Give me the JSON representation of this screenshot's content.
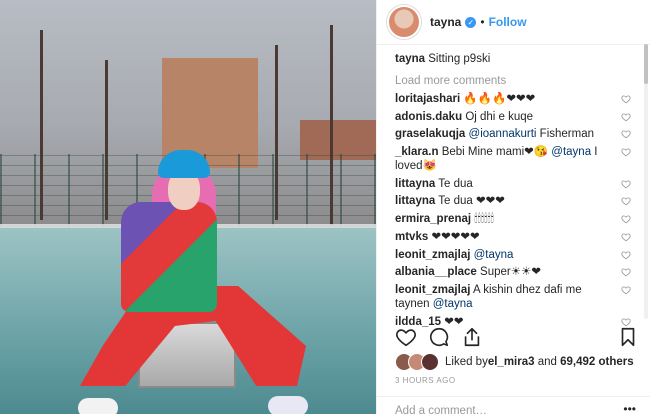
{
  "post": {
    "username": "tayna",
    "follow_label": "Follow",
    "dot": "•",
    "verified_glyph": "✓",
    "caption_user": "tayna",
    "caption_text": "Sitting p9ski",
    "load_more": "Load more comments",
    "comments": [
      {
        "user": "loritajashari",
        "parts": [
          {
            "t": "🔥🔥🔥❤❤❤",
            "m": false
          }
        ]
      },
      {
        "user": "adonis.daku",
        "parts": [
          {
            "t": "Oj dhi e kuqe",
            "m": false
          }
        ]
      },
      {
        "user": "graselakuqja",
        "parts": [
          {
            "t": "@ioannakurti",
            "m": true
          },
          {
            "t": " Fisherman",
            "m": false
          }
        ]
      },
      {
        "user": "_klara.n",
        "parts": [
          {
            "t": "Bebi Mine mami❤😘 ",
            "m": false
          },
          {
            "t": "@tayna",
            "m": true
          },
          {
            "t": " I loved😻",
            "m": false
          }
        ]
      },
      {
        "user": "littayna",
        "parts": [
          {
            "t": "Te dua",
            "m": false
          }
        ]
      },
      {
        "user": "littayna",
        "parts": [
          {
            "t": "Te dua ❤❤❤",
            "m": false
          }
        ]
      },
      {
        "user": "ermira_prenaj",
        "parts": [
          {
            "t": "🕯🕯🕯🕯🕯🕯",
            "m": false
          }
        ]
      },
      {
        "user": "mtvks",
        "parts": [
          {
            "t": "❤❤❤❤❤",
            "m": false
          }
        ]
      },
      {
        "user": "leonit_zmajlaj",
        "parts": [
          {
            "t": "@tayna",
            "m": true
          }
        ]
      },
      {
        "user": "albania__place",
        "parts": [
          {
            "t": "Super☀☀❤",
            "m": false
          }
        ]
      },
      {
        "user": "leonit_zmajlaj",
        "parts": [
          {
            "t": "A kishin dhez dafi me taynen ",
            "m": false
          },
          {
            "t": "@tayna",
            "m": true
          }
        ]
      },
      {
        "user": "ildda_15",
        "parts": [
          {
            "t": "❤❤",
            "m": false
          }
        ]
      }
    ],
    "likes_prefix": "Liked by ",
    "likes_user": "el_mira3",
    "likes_and": " and ",
    "likes_count": "69,492 others",
    "time": "3 HOURS AGO",
    "add_comment": "Add a comment…",
    "more": "•••",
    "icons": [
      "heart-icon",
      "comment-icon",
      "share-icon",
      "bookmark-icon",
      "more-options-icon"
    ],
    "colors": {
      "accent": "#3897f0",
      "mention": "#003569",
      "muted": "#999999"
    }
  }
}
